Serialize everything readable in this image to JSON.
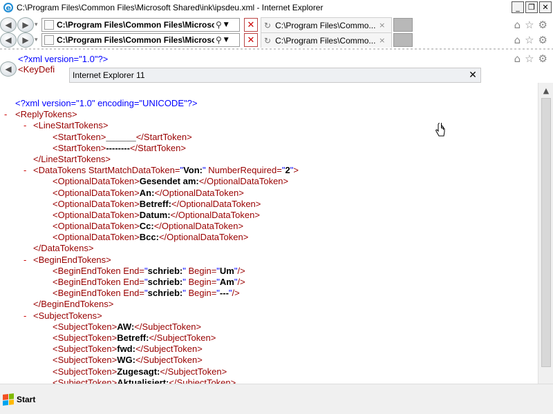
{
  "window": {
    "title": "C:\\Program Files\\Common Files\\Microsoft Shared\\ink\\ipsdeu.xml - Internet Explorer",
    "minimize": "_",
    "maximize": "❐",
    "close": "✕"
  },
  "nav": {
    "back": "◀",
    "forward": "▶",
    "address": "C:\\Program Files\\Common Files\\Microsoft",
    "search_icon": "search-icon",
    "tab_title": "C:\\Program Files\\Commo...",
    "tab_close": "×",
    "stop": "✕"
  },
  "ghost": {
    "line1": "<?xml version=\"1.0\"?>",
    "line2": "<KeyDefi"
  },
  "dialog": {
    "title": "Internet Explorer 11",
    "close": "✕"
  },
  "xml": {
    "decl": "<?xml version=\"1.0\" encoding=\"UNICODE\"?>",
    "reply_open": "<ReplyTokens>",
    "line_start_open": "<LineStartTokens>",
    "start_token_1": [
      "<StartToken>",
      "______",
      "</StartToken>"
    ],
    "start_token_2": [
      "<StartToken>",
      "--------",
      "</StartToken>"
    ],
    "line_start_close": "</LineStartTokens>",
    "data_tokens_open": {
      "tag": "<DataTokens ",
      "attr1": "StartMatchDataToken=",
      "val1": "Von:",
      "attr2": " NumberRequired=",
      "val2": "2",
      "end": ">"
    },
    "optional": [
      "Gesendet am:",
      "An:",
      "Betreff:",
      "Datum:",
      "Cc:",
      "Bcc:"
    ],
    "optional_open": "<OptionalDataToken>",
    "optional_close": "</OptionalDataToken>",
    "data_tokens_close": "</DataTokens>",
    "begin_end_open": "<BeginEndTokens>",
    "begin_end": [
      {
        "end": "schrieb:",
        "begin": "Um"
      },
      {
        "end": "schrieb:",
        "begin": "Am"
      },
      {
        "end": "schrieb:",
        "begin": "---"
      }
    ],
    "begin_end_tag": "<BeginEndToken ",
    "begin_end_attr_end": "End=",
    "begin_end_attr_begin": " Begin=",
    "begin_end_self_close": "/>",
    "begin_end_close": "</BeginEndTokens>",
    "subject_open": "<SubjectTokens>",
    "subject": [
      "AW:",
      "Betreff:",
      "fwd:",
      "WG:",
      "Zugesagt:",
      "Aktualisiert:"
    ],
    "subject_tag_open": "<SubjectToken>",
    "subject_tag_close": "</SubjectToken>"
  },
  "taskbar": {
    "start": "Start"
  }
}
